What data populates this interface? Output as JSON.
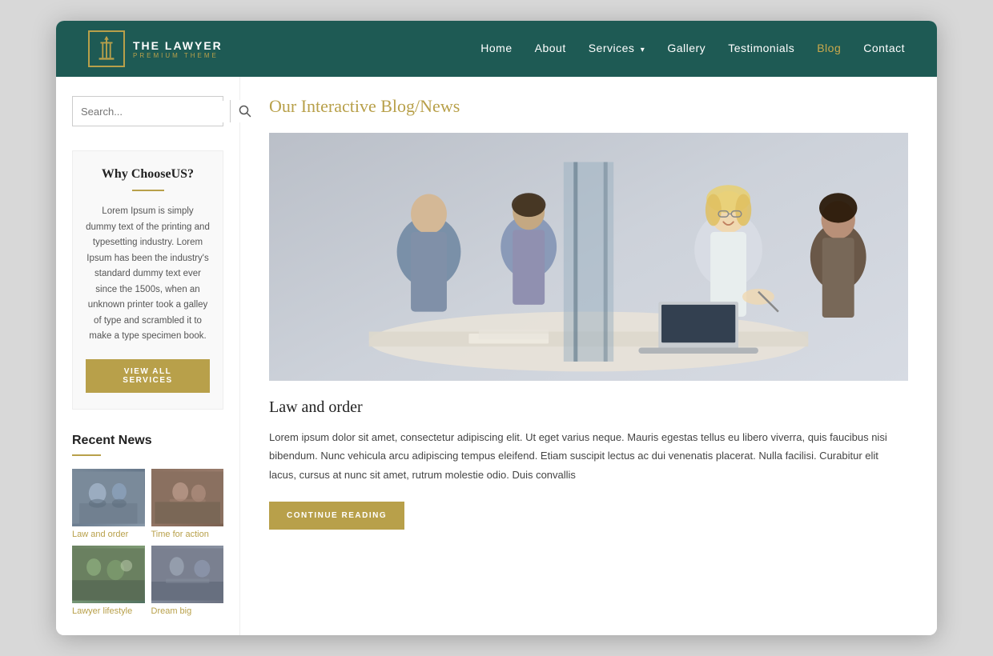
{
  "logo": {
    "title": "THE LAWYER",
    "subtitle": "PREMIUM THEME"
  },
  "nav": {
    "items": [
      {
        "label": "Home",
        "active": false,
        "has_dropdown": false
      },
      {
        "label": "About",
        "active": false,
        "has_dropdown": false
      },
      {
        "label": "Services",
        "active": false,
        "has_dropdown": true
      },
      {
        "label": "Gallery",
        "active": false,
        "has_dropdown": false
      },
      {
        "label": "Testimonials",
        "active": false,
        "has_dropdown": false
      },
      {
        "label": "Blog",
        "active": true,
        "has_dropdown": false
      },
      {
        "label": "Contact",
        "active": false,
        "has_dropdown": false
      }
    ]
  },
  "sidebar": {
    "search_placeholder": "Search...",
    "why_choose": {
      "title": "Why ChooseUS?",
      "body": "Lorem Ipsum is simply dummy text of the printing and typesetting industry. Lorem Ipsum has been the industry's standard dummy text ever since the 1500s, when an unknown printer took a galley of type and scrambled it to make a type specimen book.",
      "button_label": "VIEW ALL SERVICES"
    },
    "recent_news": {
      "title": "Recent News",
      "items": [
        {
          "label": "Law and order"
        },
        {
          "label": "Time for action"
        },
        {
          "label": "Lawyer lifestyle"
        },
        {
          "label": "Dream big"
        }
      ]
    }
  },
  "main": {
    "heading": "Our Interactive Blog/News",
    "article": {
      "title": "Law and order",
      "body": "Lorem ipsum dolor sit amet, consectetur adipiscing elit. Ut eget varius neque. Mauris egestas tellus eu libero viverra, quis faucibus nisi bibendum. Nunc vehicula arcu adipiscing tempus eleifend. Etiam suscipit lectus ac dui venenatis placerat. Nulla facilisi. Curabitur elit lacus, cursus at nunc sit amet, rutrum molestie odio. Duis convallis",
      "continue_label": "CONTINUE READING"
    }
  }
}
